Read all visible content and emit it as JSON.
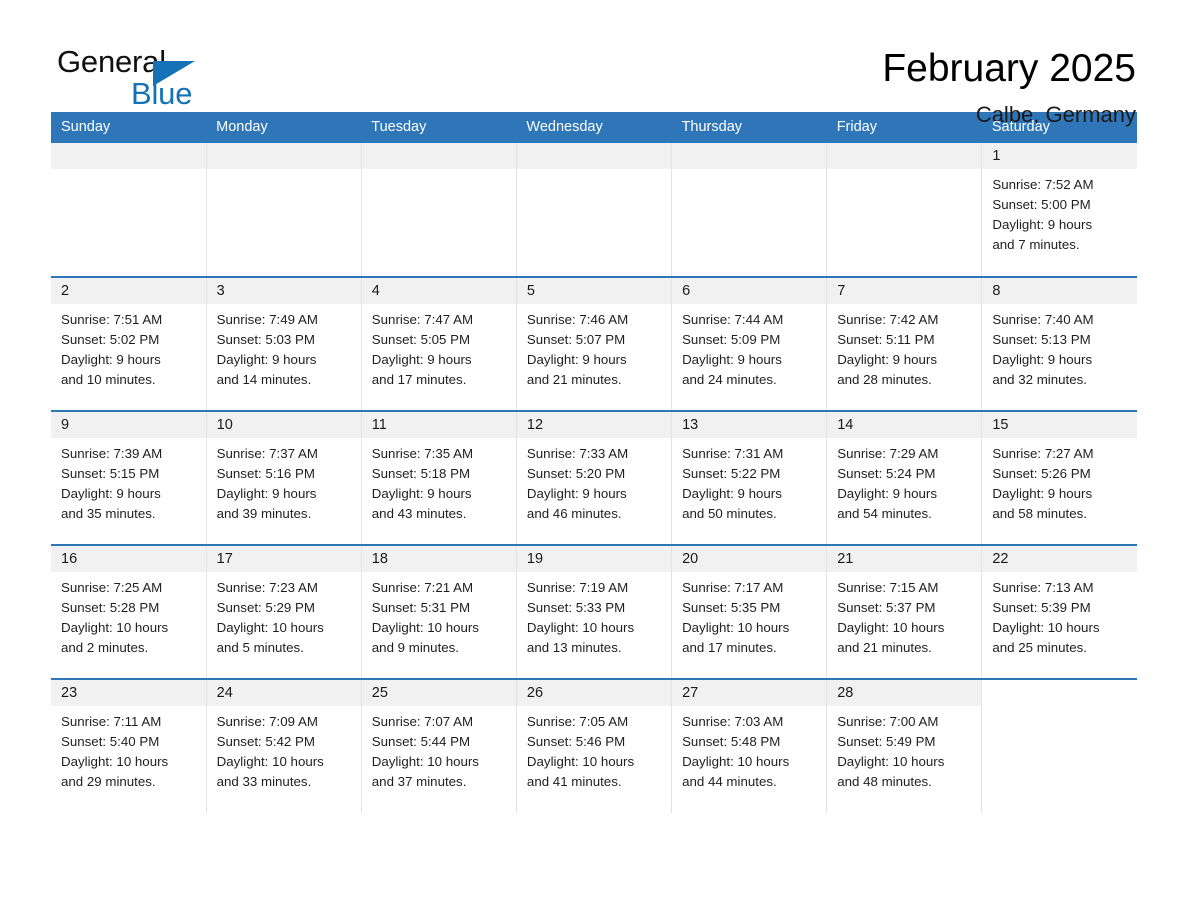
{
  "brand": {
    "name_part1": "General",
    "name_part2": "Blue",
    "accent_color": "#1572b6",
    "triangle_icon": "triangle-icon"
  },
  "header": {
    "title": "February 2025",
    "location": "Calbe, Germany"
  },
  "calendar": {
    "header_bg": "#2e76b8",
    "row_border_color": "#2e76b8",
    "daynum_band_bg": "#f1f1f1",
    "weekdays": [
      "Sunday",
      "Monday",
      "Tuesday",
      "Wednesday",
      "Thursday",
      "Friday",
      "Saturday"
    ],
    "labels": {
      "sunrise": "Sunrise:",
      "sunset": "Sunset:",
      "daylight": "Daylight:"
    },
    "weeks": [
      [
        {
          "day": "",
          "lines": []
        },
        {
          "day": "",
          "lines": []
        },
        {
          "day": "",
          "lines": []
        },
        {
          "day": "",
          "lines": []
        },
        {
          "day": "",
          "lines": []
        },
        {
          "day": "",
          "lines": []
        },
        {
          "day": "1",
          "lines": [
            "Sunrise: 7:52 AM",
            "Sunset: 5:00 PM",
            "Daylight: 9 hours",
            "and 7 minutes."
          ]
        }
      ],
      [
        {
          "day": "2",
          "lines": [
            "Sunrise: 7:51 AM",
            "Sunset: 5:02 PM",
            "Daylight: 9 hours",
            "and 10 minutes."
          ]
        },
        {
          "day": "3",
          "lines": [
            "Sunrise: 7:49 AM",
            "Sunset: 5:03 PM",
            "Daylight: 9 hours",
            "and 14 minutes."
          ]
        },
        {
          "day": "4",
          "lines": [
            "Sunrise: 7:47 AM",
            "Sunset: 5:05 PM",
            "Daylight: 9 hours",
            "and 17 minutes."
          ]
        },
        {
          "day": "5",
          "lines": [
            "Sunrise: 7:46 AM",
            "Sunset: 5:07 PM",
            "Daylight: 9 hours",
            "and 21 minutes."
          ]
        },
        {
          "day": "6",
          "lines": [
            "Sunrise: 7:44 AM",
            "Sunset: 5:09 PM",
            "Daylight: 9 hours",
            "and 24 minutes."
          ]
        },
        {
          "day": "7",
          "lines": [
            "Sunrise: 7:42 AM",
            "Sunset: 5:11 PM",
            "Daylight: 9 hours",
            "and 28 minutes."
          ]
        },
        {
          "day": "8",
          "lines": [
            "Sunrise: 7:40 AM",
            "Sunset: 5:13 PM",
            "Daylight: 9 hours",
            "and 32 minutes."
          ]
        }
      ],
      [
        {
          "day": "9",
          "lines": [
            "Sunrise: 7:39 AM",
            "Sunset: 5:15 PM",
            "Daylight: 9 hours",
            "and 35 minutes."
          ]
        },
        {
          "day": "10",
          "lines": [
            "Sunrise: 7:37 AM",
            "Sunset: 5:16 PM",
            "Daylight: 9 hours",
            "and 39 minutes."
          ]
        },
        {
          "day": "11",
          "lines": [
            "Sunrise: 7:35 AM",
            "Sunset: 5:18 PM",
            "Daylight: 9 hours",
            "and 43 minutes."
          ]
        },
        {
          "day": "12",
          "lines": [
            "Sunrise: 7:33 AM",
            "Sunset: 5:20 PM",
            "Daylight: 9 hours",
            "and 46 minutes."
          ]
        },
        {
          "day": "13",
          "lines": [
            "Sunrise: 7:31 AM",
            "Sunset: 5:22 PM",
            "Daylight: 9 hours",
            "and 50 minutes."
          ]
        },
        {
          "day": "14",
          "lines": [
            "Sunrise: 7:29 AM",
            "Sunset: 5:24 PM",
            "Daylight: 9 hours",
            "and 54 minutes."
          ]
        },
        {
          "day": "15",
          "lines": [
            "Sunrise: 7:27 AM",
            "Sunset: 5:26 PM",
            "Daylight: 9 hours",
            "and 58 minutes."
          ]
        }
      ],
      [
        {
          "day": "16",
          "lines": [
            "Sunrise: 7:25 AM",
            "Sunset: 5:28 PM",
            "Daylight: 10 hours",
            "and 2 minutes."
          ]
        },
        {
          "day": "17",
          "lines": [
            "Sunrise: 7:23 AM",
            "Sunset: 5:29 PM",
            "Daylight: 10 hours",
            "and 5 minutes."
          ]
        },
        {
          "day": "18",
          "lines": [
            "Sunrise: 7:21 AM",
            "Sunset: 5:31 PM",
            "Daylight: 10 hours",
            "and 9 minutes."
          ]
        },
        {
          "day": "19",
          "lines": [
            "Sunrise: 7:19 AM",
            "Sunset: 5:33 PM",
            "Daylight: 10 hours",
            "and 13 minutes."
          ]
        },
        {
          "day": "20",
          "lines": [
            "Sunrise: 7:17 AM",
            "Sunset: 5:35 PM",
            "Daylight: 10 hours",
            "and 17 minutes."
          ]
        },
        {
          "day": "21",
          "lines": [
            "Sunrise: 7:15 AM",
            "Sunset: 5:37 PM",
            "Daylight: 10 hours",
            "and 21 minutes."
          ]
        },
        {
          "day": "22",
          "lines": [
            "Sunrise: 7:13 AM",
            "Sunset: 5:39 PM",
            "Daylight: 10 hours",
            "and 25 minutes."
          ]
        }
      ],
      [
        {
          "day": "23",
          "lines": [
            "Sunrise: 7:11 AM",
            "Sunset: 5:40 PM",
            "Daylight: 10 hours",
            "and 29 minutes."
          ]
        },
        {
          "day": "24",
          "lines": [
            "Sunrise: 7:09 AM",
            "Sunset: 5:42 PM",
            "Daylight: 10 hours",
            "and 33 minutes."
          ]
        },
        {
          "day": "25",
          "lines": [
            "Sunrise: 7:07 AM",
            "Sunset: 5:44 PM",
            "Daylight: 10 hours",
            "and 37 minutes."
          ]
        },
        {
          "day": "26",
          "lines": [
            "Sunrise: 7:05 AM",
            "Sunset: 5:46 PM",
            "Daylight: 10 hours",
            "and 41 minutes."
          ]
        },
        {
          "day": "27",
          "lines": [
            "Sunrise: 7:03 AM",
            "Sunset: 5:48 PM",
            "Daylight: 10 hours",
            "and 44 minutes."
          ]
        },
        {
          "day": "28",
          "lines": [
            "Sunrise: 7:00 AM",
            "Sunset: 5:49 PM",
            "Daylight: 10 hours",
            "and 48 minutes."
          ]
        },
        {
          "day": "",
          "lines": []
        }
      ]
    ]
  }
}
